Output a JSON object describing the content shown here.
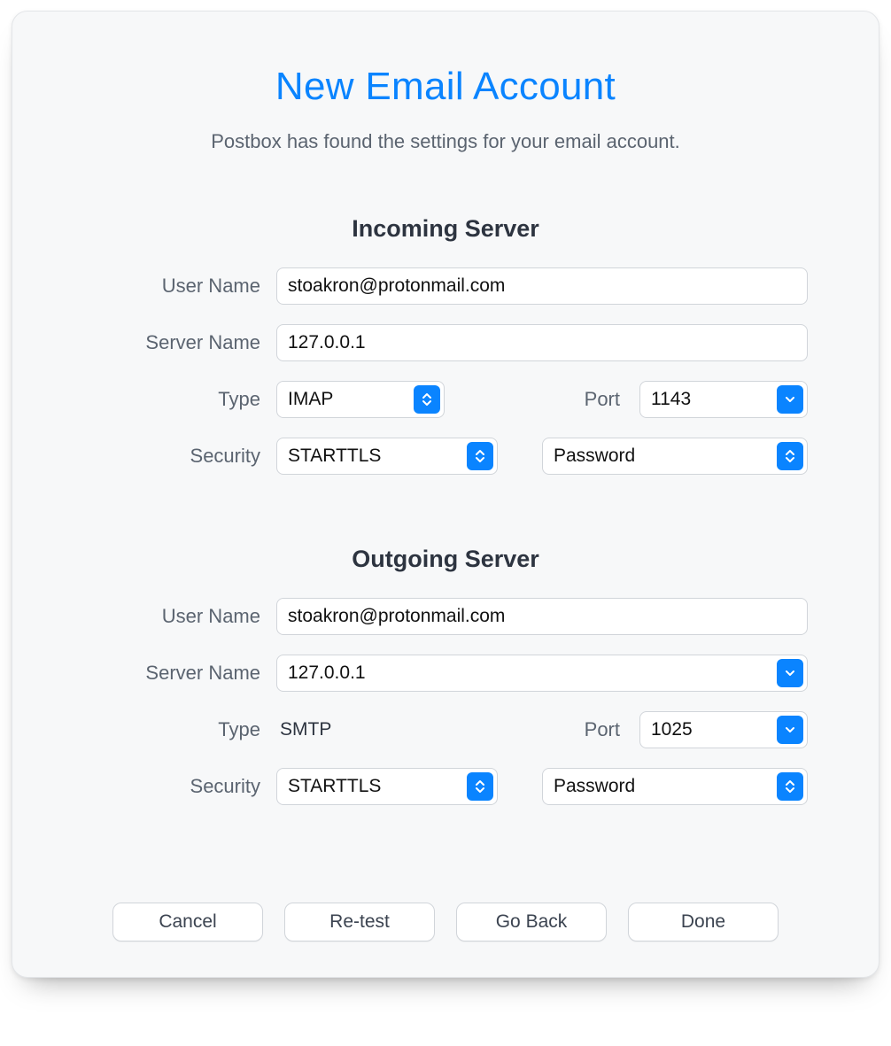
{
  "title": "New Email Account",
  "subtitle": "Postbox has found the settings for your email account.",
  "labels": {
    "user_name": "User Name",
    "server_name": "Server Name",
    "type": "Type",
    "port": "Port",
    "security": "Security"
  },
  "incoming": {
    "section_title": "Incoming Server",
    "user_name": "stoakron@protonmail.com",
    "server_name": "127.0.0.1",
    "type": "IMAP",
    "port": "1143",
    "security": "STARTTLS",
    "auth": "Password"
  },
  "outgoing": {
    "section_title": "Outgoing Server",
    "user_name": "stoakron@protonmail.com",
    "server_name": "127.0.0.1",
    "type": "SMTP",
    "port": "1025",
    "security": "STARTTLS",
    "auth": "Password"
  },
  "buttons": {
    "cancel": "Cancel",
    "retest": "Re-test",
    "go_back": "Go Back",
    "done": "Done"
  }
}
